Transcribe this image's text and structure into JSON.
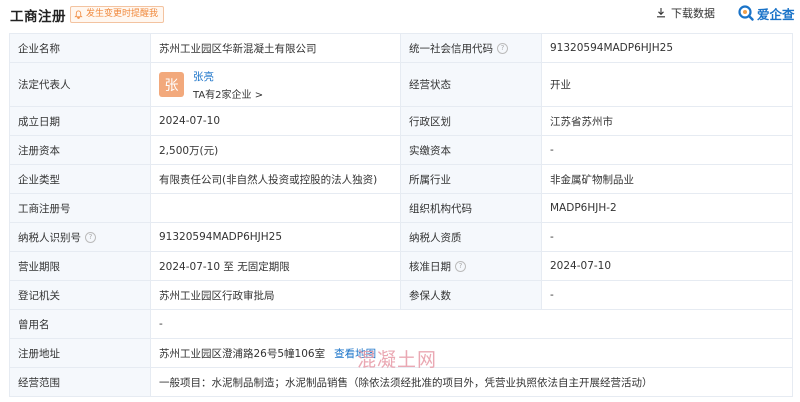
{
  "header": {
    "title": "工商注册",
    "notice": "发生变更时提醒我",
    "download_label": "下载数据",
    "brand": "爱企查"
  },
  "rows": {
    "company_name": {
      "label": "企业名称",
      "value": "苏州工业园区华新混凝土有限公司"
    },
    "credit_code": {
      "label": "统一社会信用代码",
      "value": "91320594MADP6HJH25"
    },
    "legal_rep": {
      "label": "法定代表人",
      "avatar_char": "张",
      "name": "张亮",
      "sub": "TA有2家企业 >"
    },
    "status": {
      "label": "经营状态",
      "value": "开业"
    },
    "founded": {
      "label": "成立日期",
      "value": "2024-07-10"
    },
    "region": {
      "label": "行政区划",
      "value": "江苏省苏州市"
    },
    "capital": {
      "label": "注册资本",
      "value": "2,500万(元)"
    },
    "paid_capital": {
      "label": "实缴资本",
      "value": "-"
    },
    "company_type": {
      "label": "企业类型",
      "value": "有限责任公司(非自然人投资或控股的法人独资)"
    },
    "industry": {
      "label": "所属行业",
      "value": "非金属矿物制品业"
    },
    "reg_no": {
      "label": "工商注册号",
      "value": ""
    },
    "org_code": {
      "label": "组织机构代码",
      "value": "MADP6HJH-2"
    },
    "taxpayer_id": {
      "label": "纳税人识别号",
      "value": "91320594MADP6HJH25"
    },
    "taxpayer_qual": {
      "label": "纳税人资质",
      "value": "-"
    },
    "term": {
      "label": "营业期限",
      "value": "2024-07-10 至 无固定期限"
    },
    "approval_date": {
      "label": "核准日期",
      "value": "2024-07-10"
    },
    "authority": {
      "label": "登记机关",
      "value": "苏州工业园区行政审批局"
    },
    "insured": {
      "label": "参保人数",
      "value": "-"
    },
    "former_name": {
      "label": "曾用名",
      "value": "-"
    },
    "address": {
      "label": "注册地址",
      "value": "苏州工业园区澄浦路26号5幢106室",
      "link": "查看地图"
    },
    "scope": {
      "label": "经营范围",
      "value": "一般项目：水泥制品制造；水泥制品销售（除依法须经批准的项目外，凭营业执照依法自主开展经营活动）"
    }
  },
  "watermark": "混凝土网",
  "colors": {
    "accent": "#1a73c8",
    "label_bg": "#f5f8fc",
    "border": "#e6ebf2",
    "avatar": "#f2a97c",
    "notice": "#f08a3e"
  }
}
